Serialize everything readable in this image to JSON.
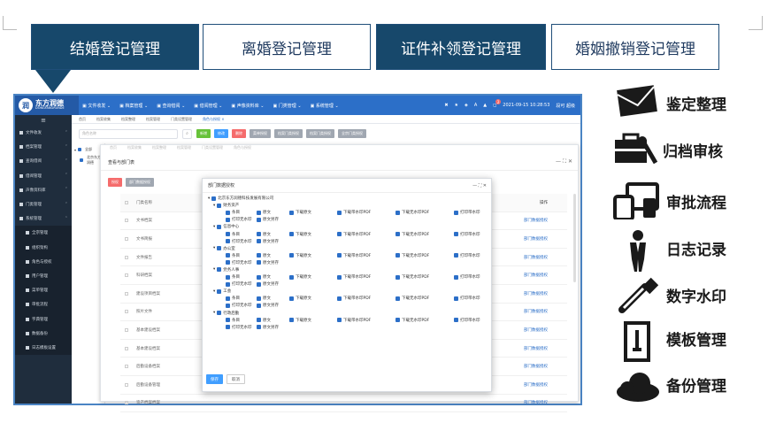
{
  "tabs": [
    {
      "label": "结婚登记管理"
    },
    {
      "label": "离婚登记管理"
    },
    {
      "label": "证件补领登记管理"
    },
    {
      "label": "婚姻撤销登记管理"
    }
  ],
  "app": {
    "logo_cn": "东方润德",
    "logo_en": "DONGFANGRUNDE",
    "menu": [
      "文件收发",
      "档案管理",
      "查询借阅",
      "借阅管理",
      "声像资料库",
      "门类管理",
      "系统管理"
    ],
    "datetime": "2021-09-15 10:28:53",
    "user": "段可 超级",
    "badge": "2",
    "sidebar": [
      "文件收发",
      "档案管理",
      "查询借阅",
      "借阅管理",
      "声像资料库",
      "门类管理",
      "系统管理",
      "全宗管理",
      "组织架构",
      "角色与授权",
      "用户管理",
      "菜单管理",
      "审批流程",
      "字典管理",
      "数据备份",
      "日志模板设置"
    ],
    "pagetabs": [
      "首页",
      "档案收集",
      "档案整理",
      "档案管理",
      "门类设置管理",
      "角色与授权"
    ],
    "search_placeholder": "角色名称",
    "buttons": [
      "新增",
      "修改",
      "删除",
      "菜单授权",
      "档案门类授权",
      "档案门类授权",
      "全宗门类授权"
    ],
    "tree_root": "全部",
    "tree_child": "北京东方润德",
    "layer_title": "查看与部门表",
    "layer_buttons": [
      "授权",
      "部门数据授权"
    ],
    "table_header": [
      "门类名称",
      "操作"
    ],
    "table_rows": [
      "文书档案",
      "文书简报",
      "文件报告",
      "科研档案",
      "建设项目档案",
      "照片文件",
      "基本建设档案",
      "基本建设档案",
      "后勤设备档案",
      "后勤设备管理",
      "资产档案档案"
    ],
    "row_action": "部门数据授权"
  },
  "modal": {
    "title": "部门数据授权",
    "root": "北京东方润德科技发展有限公司",
    "departments": [
      "财务资产",
      "信息中心",
      "办公室",
      "党务人事",
      "工会",
      "行政后勤"
    ],
    "perms_row1": [
      "条目",
      "原文",
      "下载原文",
      "下载带水印PDF",
      "下载无水印PDF",
      "打印带水印"
    ],
    "perms_row2": [
      "打印无水印",
      "原文另存"
    ],
    "confirm": "保存",
    "cancel": "取消"
  },
  "features": [
    {
      "label": "鉴定整理",
      "icon": "mail-icon"
    },
    {
      "label": "归档审核",
      "icon": "toolbox-icon"
    },
    {
      "label": "审批流程",
      "icon": "devices-icon"
    },
    {
      "label": "日志记录",
      "icon": "person-icon"
    },
    {
      "label": "数字水印",
      "icon": "dropper-icon"
    },
    {
      "label": "模板管理",
      "icon": "document-icon"
    },
    {
      "label": "备份管理",
      "icon": "cloud-icon"
    }
  ],
  "colors": {
    "tab_dark": "#17486b",
    "topbar": "#2c6fc8",
    "sidebar": "#1f2d3d",
    "accent_green": "#67c23a",
    "accent_red": "#f56c6c",
    "accent_blue": "#409eff"
  }
}
